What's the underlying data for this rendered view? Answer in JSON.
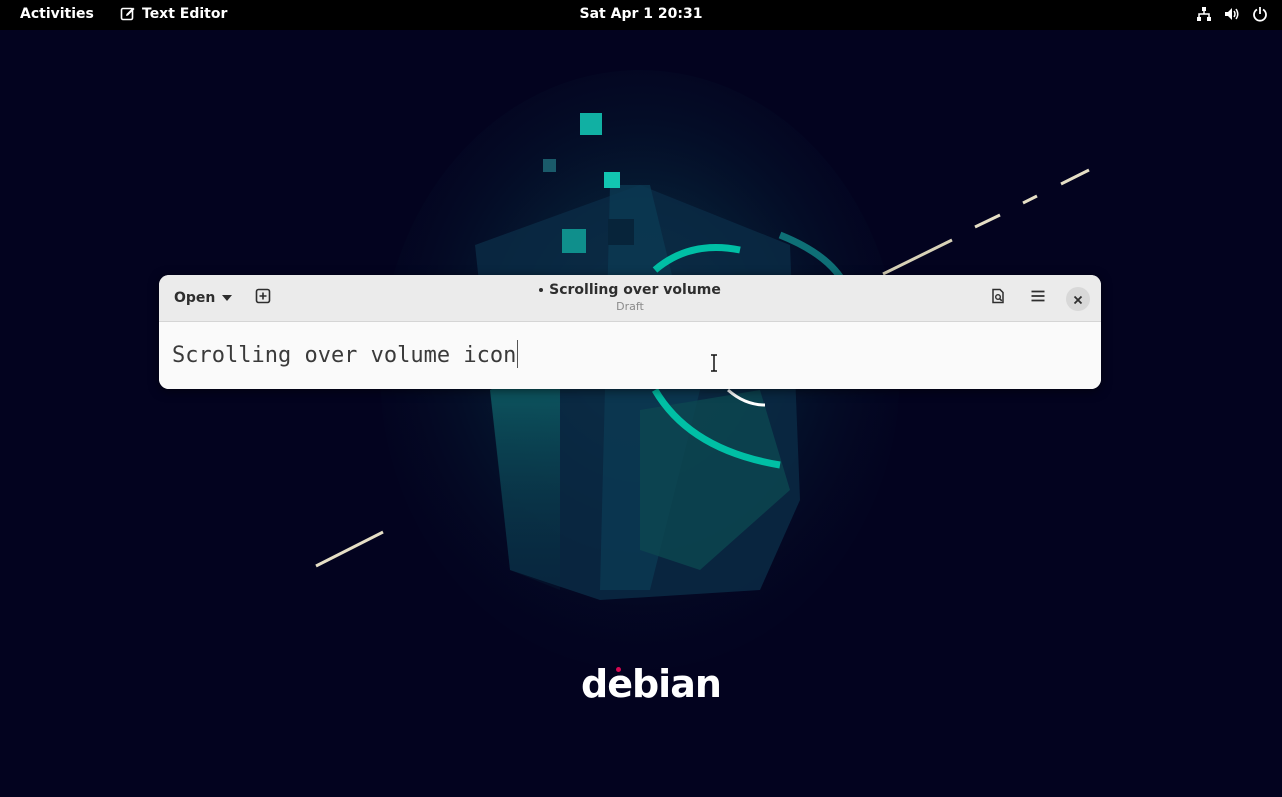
{
  "topbar": {
    "activities": "Activities",
    "app_name": "Text Editor",
    "clock": "Sat Apr 1  20:31",
    "icons": [
      "network-icon",
      "volume-icon",
      "power-icon"
    ]
  },
  "wallpaper": {
    "logo_text": "debian",
    "accent_color": "#00bfa5",
    "logo_dot_color": "#d70751"
  },
  "window": {
    "open_label": "Open",
    "title": "Scrolling over volume",
    "subtitle": "Draft",
    "modified": true,
    "document_text": "Scrolling over volume icon"
  },
  "colors": {
    "topbar_bg": "#000000",
    "headerbar_bg": "#ebebeb",
    "editor_bg": "#fafafa",
    "desktop_bg": "#03031f"
  }
}
